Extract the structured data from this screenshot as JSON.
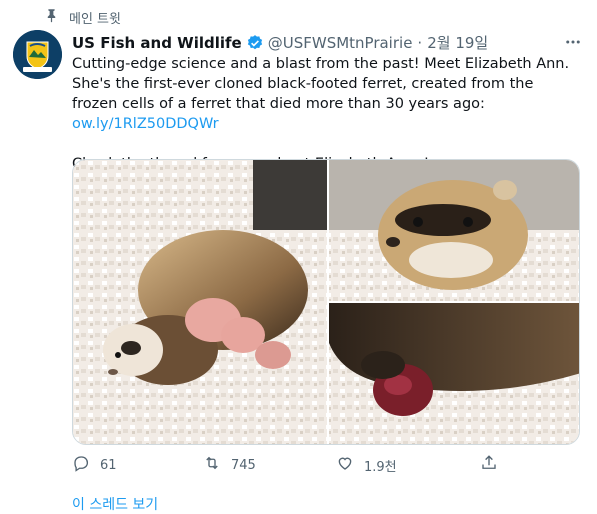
{
  "pinned": {
    "label": "메인 트윗",
    "icon": "pin-icon"
  },
  "author": {
    "name": "US Fish and Wildlife",
    "handle": "@USFWSMtnPrairie",
    "separator": "·",
    "date": "2월 19일",
    "verified": true,
    "avatar_caption": "Mountain-Prairie"
  },
  "tweet": {
    "paragraph1": "Cutting-edge science and a blast from the past! Meet Elizabeth Ann. She's the first-ever cloned black-footed ferret, created from the frozen cells of a ferret that died more than 30 years ago: ",
    "link": "ow.ly/1RlZ50DDQWr",
    "paragraph2": "Check the thread for more about Elizabeth Anne!"
  },
  "actions": {
    "reply": {
      "icon": "reply-icon",
      "count": "61"
    },
    "retweet": {
      "icon": "retweet-icon",
      "count": "745"
    },
    "like": {
      "icon": "heart-icon",
      "count": "1.9천"
    },
    "share": {
      "icon": "share-icon"
    }
  },
  "thread_link": "이 스레드 보기",
  "colors": {
    "accent": "#1d9bf0",
    "secondary_text": "#536471",
    "primary_text": "#0f1419"
  }
}
